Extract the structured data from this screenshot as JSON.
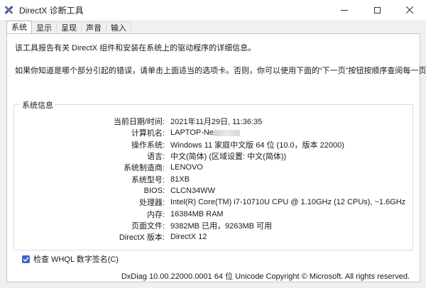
{
  "window": {
    "title": "DirectX 诊断工具"
  },
  "tabs": [
    {
      "label": "系统"
    },
    {
      "label": "显示"
    },
    {
      "label": "呈现"
    },
    {
      "label": "声音"
    },
    {
      "label": "输入"
    }
  ],
  "intro": {
    "line1": "该工具报告有关 DirectX 组件和安装在系统上的驱动程序的详细信息。",
    "line2": "如果你知道是哪个部分引起的错误，请单击上面适当的选项卡。否则，你可以使用下面的“下一页”按钮按顺序查阅每一页。"
  },
  "system_info": {
    "title": "系统信息",
    "rows": [
      {
        "label": "当前日期/时间:",
        "value": "2021年11月29日, 11:36:35"
      },
      {
        "label": "计算机名:",
        "value": "LAPTOP-Ne"
      },
      {
        "label": "操作系统:",
        "value": "Windows 11 家庭中文版 64 位 (10.0，版本 22000)"
      },
      {
        "label": "语言:",
        "value": "中文(简体) (区域设置: 中文(简体))"
      },
      {
        "label": "系统制造商:",
        "value": "LENOVO"
      },
      {
        "label": "系统型号:",
        "value": "81XB"
      },
      {
        "label": "BIOS:",
        "value": "CLCN34WW"
      },
      {
        "label": "处理器:",
        "value": "Intel(R) Core(TM) i7-10710U CPU @ 1.10GHz (12 CPUs), ~1.6GHz"
      },
      {
        "label": "内存:",
        "value": "16384MB RAM"
      },
      {
        "label": "页面文件:",
        "value": "9382MB 已用，9263MB 可用"
      },
      {
        "label": "DirectX 版本:",
        "value": "DirectX 12"
      }
    ]
  },
  "whql": {
    "label": "检查 WHQL 数字签名(C)",
    "checked": true
  },
  "footer": {
    "text": "DxDiag 10.00.22000.0001 64 位 Unicode  Copyright © Microsoft. All rights reserved."
  },
  "colors": {
    "accent": "#3d66c9"
  }
}
